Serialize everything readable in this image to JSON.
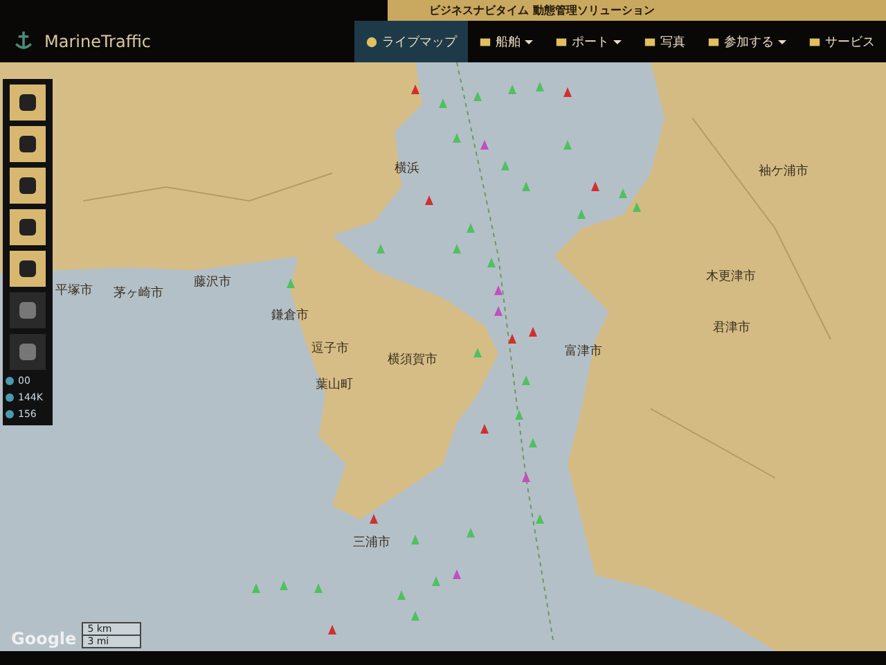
{
  "ad_banner": {
    "text": "ビジネスナビタイム 動態管理ソリューション"
  },
  "brand": "MarineTraffic",
  "nav": [
    {
      "label": "ライブマップ",
      "selected": true,
      "dropdown": false
    },
    {
      "label": "船舶",
      "selected": false,
      "dropdown": true
    },
    {
      "label": "ポート",
      "selected": false,
      "dropdown": true
    },
    {
      "label": "写真",
      "selected": false,
      "dropdown": false
    },
    {
      "label": "参加する",
      "selected": false,
      "dropdown": true
    },
    {
      "label": "サービス",
      "selected": false,
      "dropdown": false
    }
  ],
  "toolbar": [
    {
      "kind": "tool"
    },
    {
      "kind": "tool"
    },
    {
      "kind": "tool"
    },
    {
      "kind": "tool"
    },
    {
      "kind": "tool"
    },
    {
      "kind": "control"
    },
    {
      "kind": "control"
    }
  ],
  "stats": [
    "00",
    "144K",
    "156"
  ],
  "map_labels": [
    "平塚市",
    "茅ヶ崎市",
    "藤沢市",
    "鎌倉市",
    "逗子市",
    "葉山町",
    "横須賀市",
    "三浦市",
    "横浜",
    "袖ケ浦市",
    "木更津市",
    "君津市",
    "富津市"
  ],
  "attribution": "Google",
  "scale": {
    "km": "5 km",
    "mi": "3 mi"
  }
}
